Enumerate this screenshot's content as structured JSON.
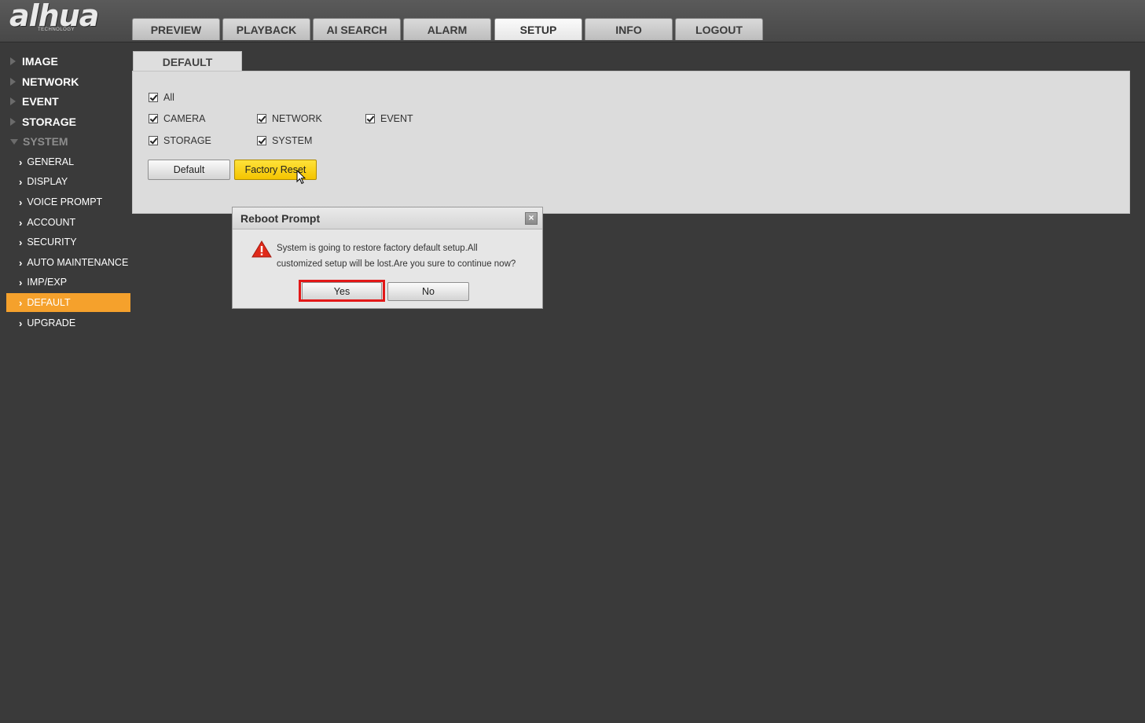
{
  "brand": {
    "logo": "alhua",
    "tagline": "TECHNOLOGY"
  },
  "nav": {
    "tabs": [
      {
        "label": "PREVIEW"
      },
      {
        "label": "PLAYBACK"
      },
      {
        "label": "AI SEARCH"
      },
      {
        "label": "ALARM"
      },
      {
        "label": "SETUP",
        "active": true
      },
      {
        "label": "INFO"
      },
      {
        "label": "LOGOUT"
      }
    ]
  },
  "sidebar": {
    "sections": [
      {
        "label": "IMAGE"
      },
      {
        "label": "NETWORK"
      },
      {
        "label": "EVENT"
      },
      {
        "label": "STORAGE"
      },
      {
        "label": "SYSTEM",
        "expanded": true
      }
    ],
    "system_items": [
      {
        "label": "GENERAL"
      },
      {
        "label": "DISPLAY"
      },
      {
        "label": "VOICE PROMPT"
      },
      {
        "label": "ACCOUNT"
      },
      {
        "label": "SECURITY"
      },
      {
        "label": "AUTO MAINTENANCE"
      },
      {
        "label": "IMP/EXP"
      },
      {
        "label": "DEFAULT",
        "active": true
      },
      {
        "label": "UPGRADE"
      }
    ],
    "active_color": "#f5a12c"
  },
  "content": {
    "tab_label": "DEFAULT",
    "checkboxes": {
      "all": {
        "label": "All",
        "checked": true
      },
      "camera": {
        "label": "CAMERA",
        "checked": true
      },
      "network": {
        "label": "NETWORK",
        "checked": true
      },
      "event": {
        "label": "EVENT",
        "checked": true
      },
      "storage": {
        "label": "STORAGE",
        "checked": true
      },
      "system": {
        "label": "SYSTEM",
        "checked": true
      }
    },
    "buttons": {
      "default": "Default",
      "factory_reset": "Factory Reset"
    }
  },
  "dialog": {
    "title": "Reboot Prompt",
    "message_line1": "System is going to restore factory default setup.All",
    "message_line2": "customized setup will be lost.Are you sure to continue now?",
    "yes_label": "Yes",
    "no_label": "No",
    "highlight_color": "#e21818"
  }
}
